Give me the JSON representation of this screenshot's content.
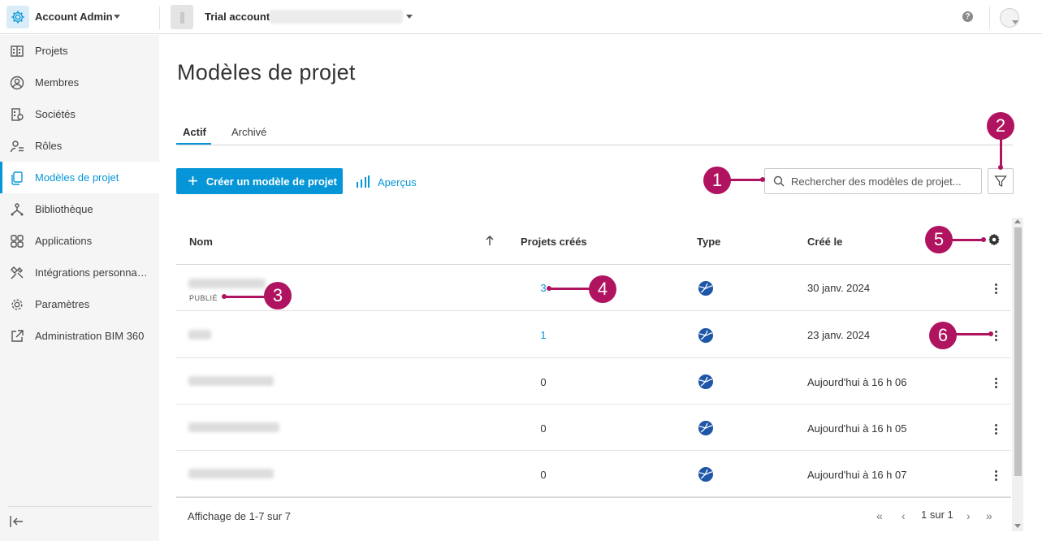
{
  "topbar": {
    "app_title": "Account Admin",
    "account_name": "Trial account",
    "help_glyph": "?"
  },
  "sidebar": {
    "items": [
      {
        "label": "Projets",
        "icon": "building-icon"
      },
      {
        "label": "Membres",
        "icon": "person-circle-icon"
      },
      {
        "label": "Sociétés",
        "icon": "company-icon"
      },
      {
        "label": "Rôles",
        "icon": "roles-icon"
      },
      {
        "label": "Modèles de projet",
        "icon": "templates-icon",
        "active": true
      },
      {
        "label": "Bibliothèque",
        "icon": "library-icon"
      },
      {
        "label": "Applications",
        "icon": "apps-grid-icon"
      },
      {
        "label": "Intégrations personna…",
        "icon": "integrations-icon"
      },
      {
        "label": "Paramètres",
        "icon": "gear-icon"
      },
      {
        "label": "Administration BIM 360",
        "icon": "external-link-icon"
      }
    ]
  },
  "main": {
    "page_title": "Modèles de projet",
    "tabs": [
      {
        "label": "Actif",
        "active": true
      },
      {
        "label": "Archivé",
        "active": false
      }
    ],
    "create_button": "Créer un modèle de projet",
    "insights_button": "Aperçus",
    "search_placeholder": "Rechercher des modèles de projet...",
    "accent_color": "#0696d7"
  },
  "table": {
    "columns": [
      "Nom",
      "Projets créés",
      "Type",
      "Créé le"
    ],
    "rows": [
      {
        "status": "PUBLIÉ",
        "projects": "3",
        "date": "30 janv. 2024",
        "link": true
      },
      {
        "status": "",
        "projects": "1",
        "date": "23 janv. 2024",
        "link": true
      },
      {
        "status": "",
        "projects": "0",
        "date": "Aujourd'hui à 16 h 06",
        "link": false
      },
      {
        "status": "",
        "projects": "0",
        "date": "Aujourd'hui à 16 h 05",
        "link": false
      },
      {
        "status": "",
        "projects": "0",
        "date": "Aujourd'hui à 16 h 07",
        "link": false
      }
    ],
    "footer": "Affichage de 1-7 sur 7",
    "pagination": "1 sur 1"
  },
  "callouts": [
    "1",
    "2",
    "3",
    "4",
    "5",
    "6"
  ],
  "callout_color": "#b0135f"
}
